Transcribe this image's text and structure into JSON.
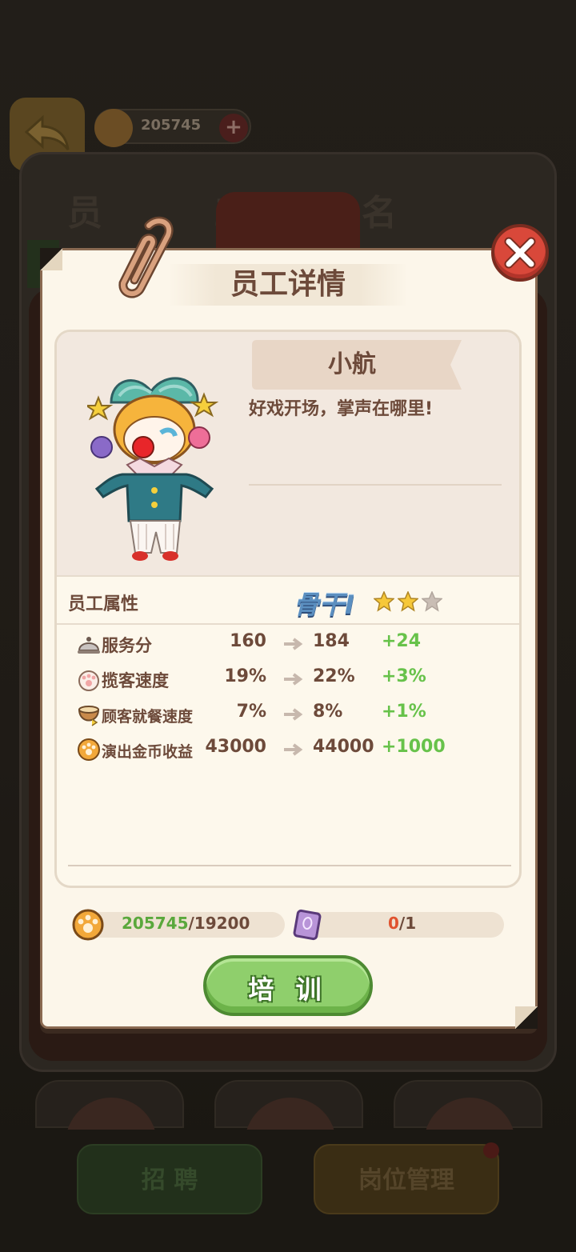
{
  "background": {
    "coin_value": "205745",
    "book_title": "员工名册",
    "tab_label": "员工",
    "recruit_label": "招 聘",
    "post_label": "岗位管理"
  },
  "modal": {
    "title": "员工详情",
    "employee": {
      "name": "小航",
      "quote": "好戏开场，掌声在哪里!"
    },
    "attributes": {
      "label": "员工属性",
      "rank": "骨干I",
      "stars_filled": 2,
      "stars_total": 3
    },
    "stats": [
      {
        "icon": "service-bell-icon",
        "label": "服务分",
        "current": "160",
        "next": "184",
        "diff": "+24"
      },
      {
        "icon": "paw-glove-icon",
        "label": "揽客速度",
        "current": "19%",
        "next": "22%",
        "diff": "+3%"
      },
      {
        "icon": "dining-bowl-icon",
        "label": "顾客就餐速度",
        "current": "7%",
        "next": "8%",
        "diff": "+1%"
      },
      {
        "icon": "paw-coin-icon",
        "label": "演出金币收益",
        "current": "43000",
        "next": "44000",
        "diff": "+1000"
      }
    ],
    "resources": {
      "coins_have": "205745",
      "coins_need": "/19200",
      "books_have": "0",
      "books_need": "/1"
    },
    "train_button": "培 训"
  },
  "colors": {
    "text_brown": "#6d4a3a",
    "gain_green": "#67c24a",
    "button_green": "#8fcf6c",
    "close_red": "#d9483a"
  }
}
